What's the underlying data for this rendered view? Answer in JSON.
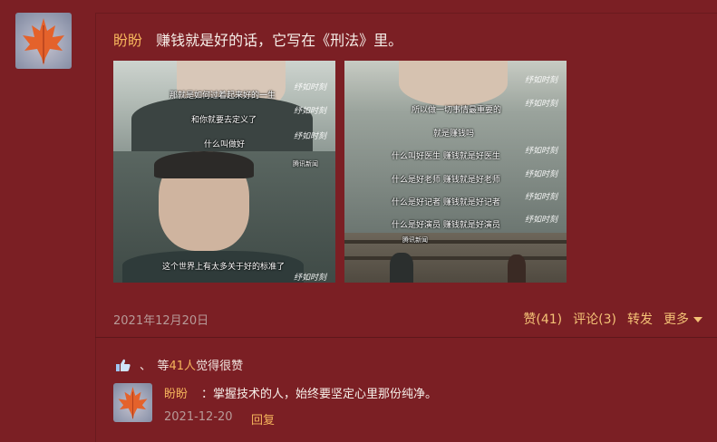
{
  "post": {
    "username": "盼盼",
    "text": "赚钱就是好的话，它写在《刑法》里。",
    "date": "2021年12月20日"
  },
  "images": {
    "left": {
      "subtitles": [
        "那就是如何过着起来好的一生",
        "和你就要去定义了",
        "什么叫做好",
        "这个世界上有太多关于好的标准了"
      ],
      "watermark": "纾如时刻",
      "logo": "腾讯新闻"
    },
    "right": {
      "subtitles": [
        "所以做一切事情最重要的",
        "就是赚钱吗",
        "什么叫好医生 赚钱就是好医生",
        "什么是好老师 赚钱就是好老师",
        "什么是好记者 赚钱就是好记者",
        "什么是好演员 赚钱就是好演员"
      ],
      "watermark": "纾如时刻",
      "logo": "腾讯新闻"
    }
  },
  "actions": {
    "like": "赞(41)",
    "comment": "评论(3)",
    "repost": "转发",
    "more": "更多"
  },
  "likes_summary": {
    "prefix": "、　等",
    "count": "41人",
    "suffix": "觉得很赞"
  },
  "reply": {
    "username": "盼盼",
    "text": "：掌握技术的人，始终要坚定心里那份纯净。",
    "date": "2021-12-20",
    "reply_label": "回复"
  }
}
